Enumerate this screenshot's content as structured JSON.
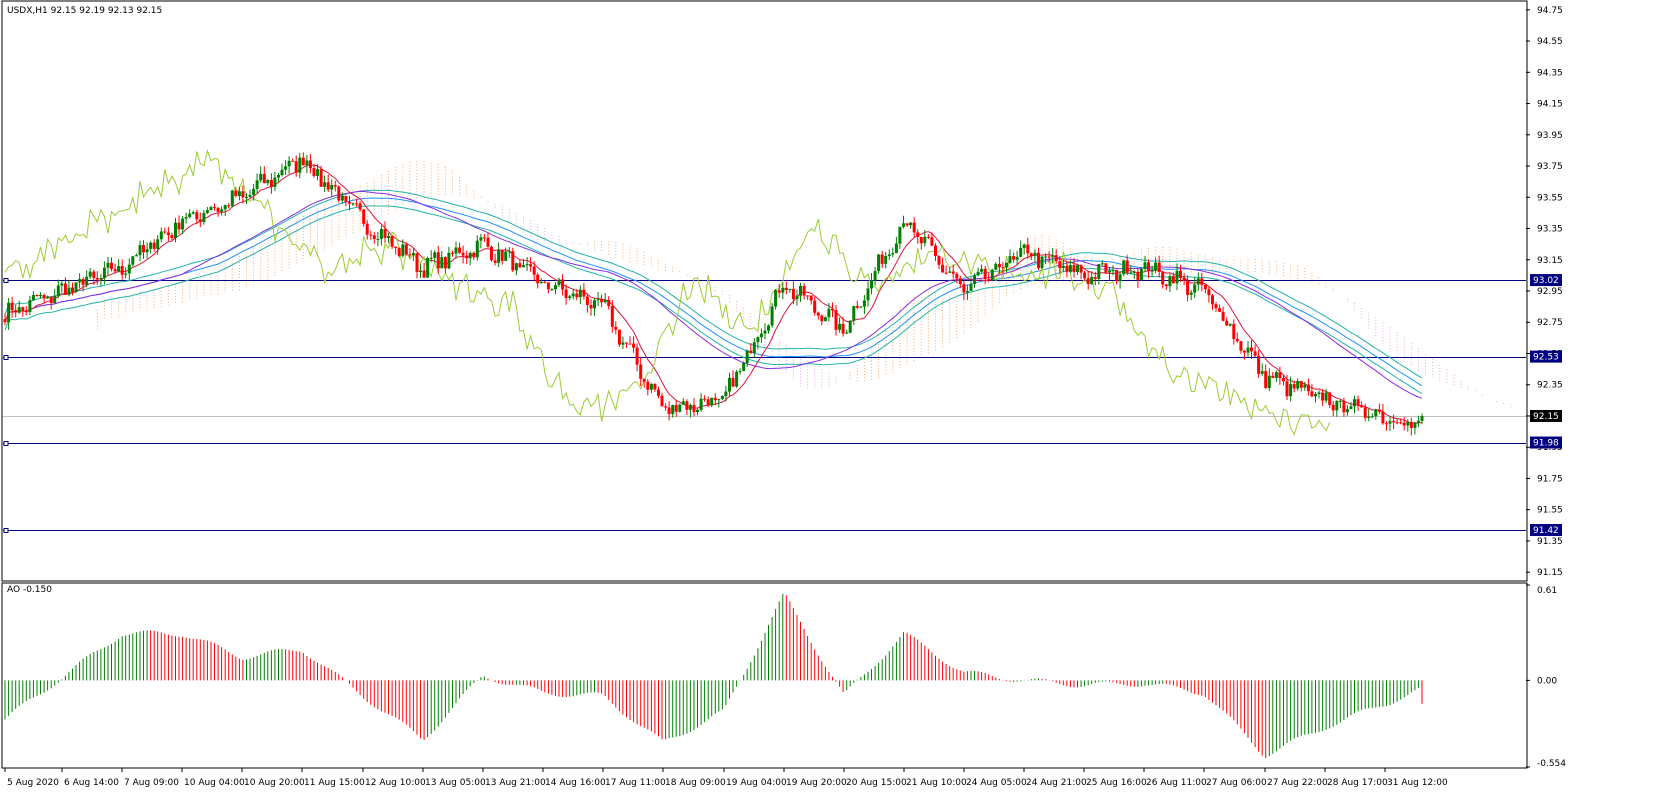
{
  "header": {
    "symbol_line": "USDX,H1  92.15 92.19 92.13 92.15",
    "indicator_label": "AO -0.150"
  },
  "chart_data": {
    "type": "candlestick",
    "symbol": "USDX",
    "timeframe": "H1",
    "ohlc_readout": {
      "open": 92.15,
      "high": 92.19,
      "low": 92.13,
      "close": 92.15
    },
    "price_axis_ticks": [
      "94.75",
      "94.55",
      "94.35",
      "94.15",
      "93.95",
      "93.75",
      "93.55",
      "93.35",
      "93.15",
      "92.95",
      "92.75",
      "92.55",
      "92.35",
      "92.15",
      "91.95",
      "91.75",
      "91.55",
      "91.35",
      "91.15"
    ],
    "price_range": [
      91.1,
      94.8
    ],
    "time_axis_labels": [
      "5 Aug 2020",
      "6 Aug 14:00",
      "7 Aug 09:00",
      "10 Aug 04:00",
      "10 Aug 20:00",
      "11 Aug 15:00",
      "12 Aug 10:00",
      "13 Aug 05:00",
      "13 Aug 21:00",
      "14 Aug 16:00",
      "17 Aug 11:00",
      "18 Aug 09:00",
      "19 Aug 04:00",
      "19 Aug 20:00",
      "20 Aug 15:00",
      "21 Aug 10:00",
      "24 Aug 05:00",
      "24 Aug 21:00",
      "25 Aug 16:00",
      "26 Aug 11:00",
      "27 Aug 06:00",
      "27 Aug 22:00",
      "28 Aug 17:00",
      "31 Aug 12:00"
    ],
    "horizontal_levels": [
      {
        "label": "93.02",
        "value": 93.02
      },
      {
        "label": "92.53",
        "value": 92.53
      },
      {
        "label": "91.98",
        "value": 91.98
      },
      {
        "label": "91.42",
        "value": 91.42
      }
    ],
    "current_price": {
      "label": "92.15",
      "value": 92.15
    },
    "key_closes": [
      {
        "time": "5 Aug 2020",
        "close": 92.8
      },
      {
        "time": "6 Aug 14:00",
        "close": 92.95
      },
      {
        "time": "7 Aug 09:00",
        "close": 93.1
      },
      {
        "time": "10 Aug 04:00",
        "close": 93.4
      },
      {
        "time": "10 Aug 20:00",
        "close": 93.55
      },
      {
        "time": "11 Aug 15:00",
        "close": 93.8
      },
      {
        "time": "12 Aug 10:00",
        "close": 93.4
      },
      {
        "time": "13 Aug 05:00",
        "close": 93.1
      },
      {
        "time": "13 Aug 21:00",
        "close": 93.25
      },
      {
        "time": "14 Aug 16:00",
        "close": 93.0
      },
      {
        "time": "17 Aug 11:00",
        "close": 92.85
      },
      {
        "time": "18 Aug 09:00",
        "close": 92.2
      },
      {
        "time": "19 Aug 04:00",
        "close": 92.25
      },
      {
        "time": "19 Aug 20:00",
        "close": 93.0
      },
      {
        "time": "20 Aug 15:00",
        "close": 92.7
      },
      {
        "time": "21 Aug 10:00",
        "close": 93.4
      },
      {
        "time": "24 Aug 05:00",
        "close": 92.95
      },
      {
        "time": "24 Aug 21:00",
        "close": 93.2
      },
      {
        "time": "25 Aug 16:00",
        "close": 93.05
      },
      {
        "time": "26 Aug 11:00",
        "close": 93.1
      },
      {
        "time": "27 Aug 06:00",
        "close": 92.95
      },
      {
        "time": "27 Aug 22:00",
        "close": 92.4
      },
      {
        "time": "28 Aug 17:00",
        "close": 92.25
      },
      {
        "time": "31 Aug 12:00",
        "close": 92.15
      }
    ],
    "indicator": {
      "name": "AO",
      "value": -0.15,
      "axis_ticks": [
        "0.61",
        "0.00",
        "-0.554"
      ],
      "range": [
        -0.554,
        0.61
      ],
      "key_values": [
        {
          "time": "5 Aug 2020",
          "value": -0.25
        },
        {
          "time": "6 Aug 14:00",
          "value": 0.02
        },
        {
          "time": "7 Aug 09:00",
          "value": 0.3
        },
        {
          "time": "10 Aug 04:00",
          "value": 0.3
        },
        {
          "time": "10 Aug 20:00",
          "value": 0.15
        },
        {
          "time": "11 Aug 15:00",
          "value": 0.2
        },
        {
          "time": "12 Aug 10:00",
          "value": -0.1
        },
        {
          "time": "13 Aug 05:00",
          "value": -0.38
        },
        {
          "time": "13 Aug 21:00",
          "value": 0.03
        },
        {
          "time": "14 Aug 16:00",
          "value": -0.08
        },
        {
          "time": "17 Aug 11:00",
          "value": -0.1
        },
        {
          "time": "18 Aug 09:00",
          "value": -0.4
        },
        {
          "time": "19 Aug 04:00",
          "value": -0.2
        },
        {
          "time": "19 Aug 20:00",
          "value": 0.55
        },
        {
          "time": "20 Aug 15:00",
          "value": -0.1
        },
        {
          "time": "21 Aug 10:00",
          "value": 0.3
        },
        {
          "time": "24 Aug 05:00",
          "value": 0.05
        },
        {
          "time": "24 Aug 21:00",
          "value": 0.0
        },
        {
          "time": "25 Aug 16:00",
          "value": -0.03
        },
        {
          "time": "26 Aug 11:00",
          "value": -0.02
        },
        {
          "time": "27 Aug 06:00",
          "value": -0.08
        },
        {
          "time": "27 Aug 22:00",
          "value": -0.48
        },
        {
          "time": "28 Aug 17:00",
          "value": -0.3
        },
        {
          "time": "31 Aug 12:00",
          "value": -0.15
        }
      ]
    }
  },
  "colors": {
    "background": "#ffffff",
    "bull_candle": "#008000",
    "bear_candle": "#ff0000",
    "level_line": "#000080",
    "level_tag": "#000080",
    "ma_fast": "#dc143c",
    "ma_slow": "#8a2be2",
    "envelope": "#20b2aa",
    "envelope_mid": "#1e90ff",
    "chikou": "#9acd32",
    "cloud_a": "#f4a460",
    "cloud_b": "#dda0dd",
    "ao_up": "#008000",
    "ao_down": "#ff0000",
    "current_tag": "#000000",
    "grid_border": "#000000"
  }
}
